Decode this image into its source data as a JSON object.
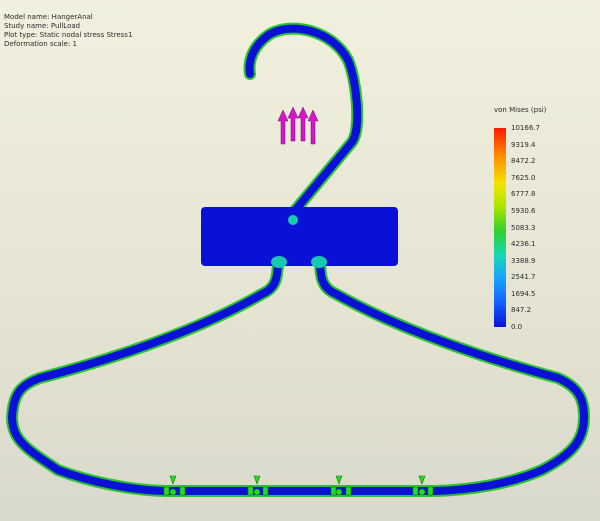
{
  "info": {
    "model_name": "Model name: HangerAnal",
    "study_name": "Study name: PullLoad",
    "plot_type": "Plot type: Static nodal stress Stress1",
    "deformation_scale": "Deformation scale: 1"
  },
  "legend": {
    "title": "von Mises (psi)",
    "ticks": [
      "10166.7",
      "9319.4",
      "8472.2",
      "7625.0",
      "6777.8",
      "5930.6",
      "5083.3",
      "4236.1",
      "3388.9",
      "2541.7",
      "1694.5",
      "847.2",
      "0.0"
    ]
  },
  "colors": {
    "base_stress": "#0a10d6",
    "medium_stress": "#17c9ad",
    "high_stress": "#29c42e",
    "load_arrows": "#d516c9",
    "fixtures": "#22dd22"
  },
  "icons": [
    "load-arrows-icon",
    "fixture-icon"
  ]
}
